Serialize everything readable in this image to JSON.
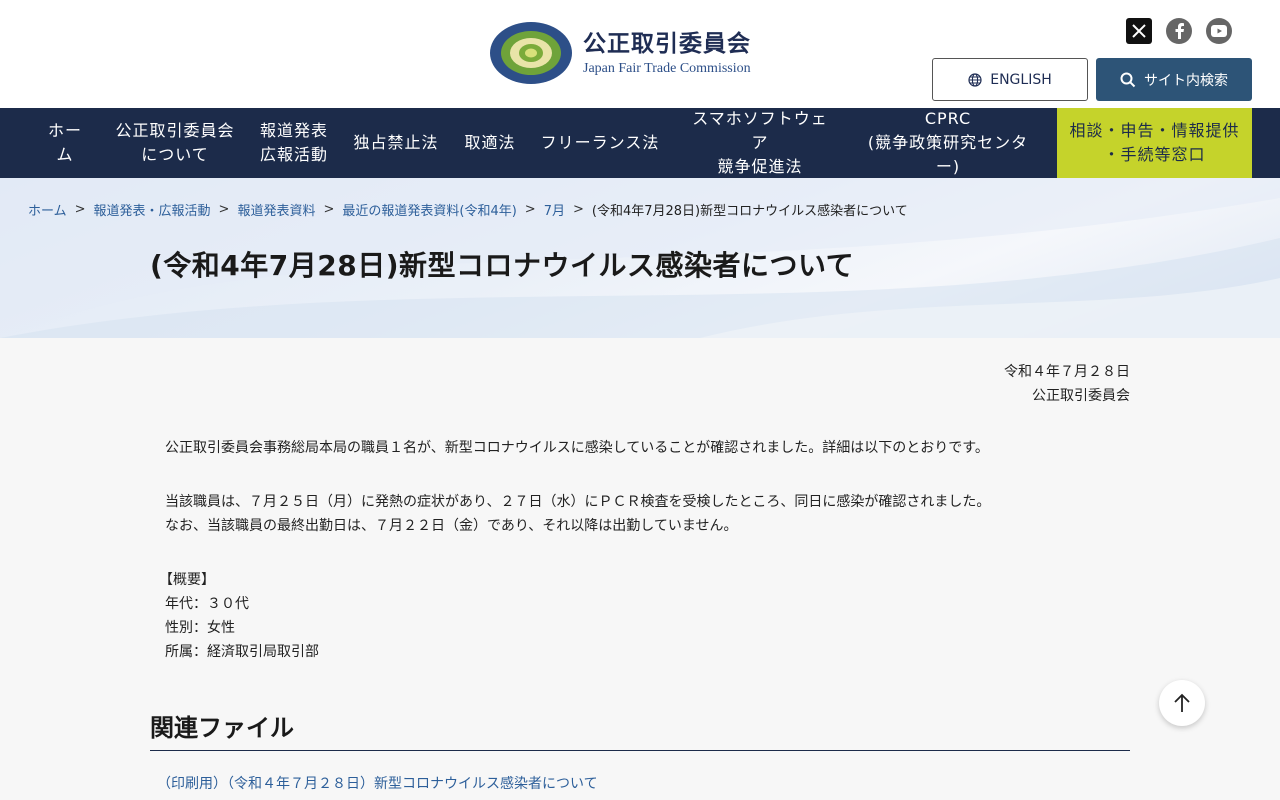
{
  "header": {
    "org_name_ja": "公正取引委員会",
    "org_name_en": "Japan Fair Trade Commission",
    "english_label": "ENGLISH",
    "search_label": "サイト内検索"
  },
  "social": {
    "icons": [
      "x-icon",
      "facebook-icon",
      "youtube-icon"
    ]
  },
  "nav": {
    "items": [
      {
        "label": "ホーム"
      },
      {
        "label": "公正取引委員会\nについて"
      },
      {
        "label": "報道発表\n広報活動"
      },
      {
        "label": "独占禁止法"
      },
      {
        "label": "取適法"
      },
      {
        "label": "フリーランス法"
      },
      {
        "label": "スマホソフトウェア\n競争促進法"
      },
      {
        "label": "CPRC\n(競争政策研究センター)"
      }
    ],
    "consult_label": "相談・申告・情報提供\n・手続等窓口"
  },
  "breadcrumb": {
    "items": [
      "ホーム",
      "報道発表・広報活動",
      "報道発表資料",
      "最近の報道発表資料(令和4年)",
      "7月"
    ],
    "separator": ">",
    "current": "(令和4年7月28日)新型コロナウイルス感染者について"
  },
  "page": {
    "title": "(令和4年7月28日)新型コロナウイルス感染者について",
    "date": "令和４年７月２８日",
    "issuer": "公正取引委員会",
    "paragraph1": "公正取引委員会事務総局本局の職員１名が、新型コロナウイルスに感染していることが確認されました。詳細は以下のとおりです。",
    "paragraph2": "当該職員は、７月２５日（月）に発熱の症状があり、２７日（水）にＰＣＲ検査を受検したところ、同日に感染が確認されました。",
    "paragraph3": "なお、当該職員の最終出勤日は、７月２２日（金）であり、それ以降は出勤していません。",
    "summary_heading": "【概要】",
    "summary_age": "年代：３０代",
    "summary_gender": "性別：女性",
    "summary_dept": "所属：経済取引局取引部"
  },
  "related": {
    "title": "関連ファイル",
    "link": "（印刷用）（令和４年７月２８日）新型コロナウイルス感染者について"
  },
  "colors": {
    "nav_bg": "#1c2b4a",
    "consult_bg": "#c5d32b",
    "search_btn": "#2d5477",
    "link": "#2d5f9a"
  }
}
